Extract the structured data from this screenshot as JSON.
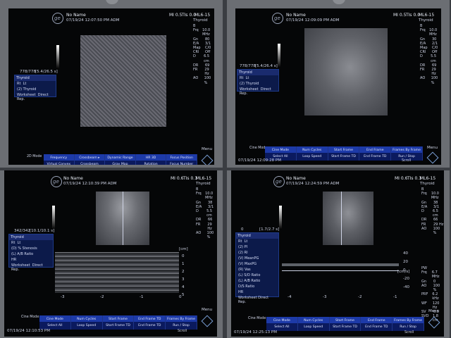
{
  "q1": {
    "patient": "No Name",
    "datetime": "07/19/24 12:07:50 PM ADM",
    "mi": "MI 0.5",
    "tis": "TIs 0.0",
    "probe": "ML6-15",
    "preset": "Thyroid",
    "params": [
      [
        "B",
        ""
      ],
      [
        "Frq",
        "10.0 MHz"
      ],
      [
        "Gn",
        "80"
      ],
      [
        "E/A",
        "3/1"
      ],
      [
        "Map",
        "C/0"
      ],
      [
        "CRI",
        "Off"
      ],
      [
        "D",
        "6.5 cm"
      ],
      [
        "DR",
        "69"
      ],
      [
        "FR",
        "29 Hz"
      ],
      [
        "AO",
        "100 %"
      ]
    ],
    "counter": "778/778",
    "cine_time": "[5.4/26.5 s]",
    "panel_title": "Thyroid",
    "panel_cols": [
      "Rt",
      "Lt"
    ],
    "panel_items": [
      "(2) Thyroid"
    ],
    "panel_footer": [
      "Worksheet",
      "Direct Rep."
    ],
    "mode": "2D\nMode",
    "softkeys": [
      "Frequency",
      "Crossbeam ▸",
      "Dynamic Range",
      "HR 3D",
      "Focus Position"
    ],
    "softkeys2": [
      "Virtual Convex",
      "Crossbeam",
      "Gray Map",
      "Rotation",
      "Focus Number"
    ],
    "menu": "Menu"
  },
  "q2": {
    "patient": "No Name",
    "datetime": "07/19/24 12:09:09 PM ADM",
    "mi": "MI 0.5",
    "tis": "TIs 0.0",
    "probe": "ML6-15",
    "preset": "Thyroid",
    "params": [
      [
        "B",
        ""
      ],
      [
        "Frq",
        "10.0 MHz"
      ],
      [
        "Gn",
        "30"
      ],
      [
        "E/A",
        "2/1"
      ],
      [
        "Map",
        "C/0"
      ],
      [
        "CRI",
        "Off"
      ],
      [
        "D",
        "5.5 cm"
      ],
      [
        "DR",
        "69"
      ],
      [
        "FR",
        "29 Hz"
      ],
      [
        "AO",
        "100 %"
      ]
    ],
    "counter": "778/778",
    "cine_time": "[5.4/26.4 s]",
    "panel_title": "Thyroid",
    "panel_cols": [
      "Rt",
      "Lt"
    ],
    "panel_items": [
      "(2) Thyroid"
    ],
    "panel_footer": [
      "Worksheet",
      "Direct Rep."
    ],
    "mode": "Cine\nMode",
    "softkeys": [
      "Cine Mode",
      "Num Cycles",
      "Start Frame",
      "End Frame",
      "Frames By Frame"
    ],
    "softkeys2": [
      "Select All",
      "Loop Speed",
      "Start Frame TD",
      "End Frame TD",
      "Run / Stop"
    ],
    "footer_time": "07/19/24 12:09:28 PM",
    "scroll": "Scroll",
    "menu": "Menu"
  },
  "q3": {
    "patient": "No Name",
    "datetime": "07/19/24 12:10:39 PM ADM",
    "mi": "MI 0.6",
    "tis": "TIs 0.1",
    "probe": "ML6-15",
    "preset": "Thyroid",
    "params": [
      [
        "B",
        ""
      ],
      [
        "Frq",
        "10.0 MHz"
      ],
      [
        "Gn",
        "38"
      ],
      [
        "E/A",
        "3/1"
      ],
      [
        "D",
        "5.5 cm"
      ],
      [
        "DR",
        "66"
      ],
      [
        "FR",
        "29 Hz"
      ],
      [
        "AO",
        "100 %"
      ]
    ],
    "counter": "342/342",
    "cine_time": "[10.1/10.1 s]",
    "panel_title": "Thyroid",
    "panel_cols": [
      "Rt",
      "Lt"
    ],
    "panel_items": [
      "(D) % Stenosis",
      "(L) A/B Ratio",
      "HR"
    ],
    "panel_footer": [
      "Worksheet",
      "Direct Rep."
    ],
    "mode": "Cine\nMode",
    "depth_unit": "[cm]",
    "mmode_scale": [
      "0",
      "1",
      "2",
      "3",
      "4",
      "5"
    ],
    "time_scale": [
      "-3",
      "-2",
      "-1",
      "0"
    ],
    "softkeys": [
      "Cine Mode",
      "Num Cycles",
      "Start Frame",
      "End Frame TD",
      "Frames By Frame"
    ],
    "softkeys2": [
      "Select All",
      "Loop Speed",
      "Start Frame TD",
      "End Frame TD",
      "Run / Stop"
    ],
    "footer_time": "07/19/24 12:10:53 PM",
    "scroll": "Scroll",
    "menu": "Menu"
  },
  "q4": {
    "patient": "No Name",
    "datetime": "07/19/24 12:24:59 PM ADM",
    "mi": "MI 0.6",
    "tis": "TIs 0.1",
    "probe": "ML6-15",
    "preset": "Thyroid",
    "params": [
      [
        "B",
        ""
      ],
      [
        "Frq",
        "10.0 MHz"
      ],
      [
        "Gn",
        "38"
      ],
      [
        "E/A",
        "3/1"
      ],
      [
        "D",
        "6.5 cm"
      ],
      [
        "DR",
        "66"
      ],
      [
        "FR",
        "29 Hz"
      ],
      [
        "AO",
        "100 %"
      ]
    ],
    "pw_params": [
      [
        "PW",
        ""
      ],
      [
        "Frq",
        "6.7 MHz"
      ],
      [
        "Gn",
        "0"
      ],
      [
        "AO",
        "100 %"
      ],
      [
        "PRF",
        "6.2 kHz"
      ],
      [
        "WF",
        "120 Hz"
      ],
      [
        "SV",
        "0.5"
      ],
      [
        "SVD",
        "1.8 cm"
      ]
    ],
    "counter": "0",
    "cine_time": "[1.7/2.7 s]",
    "panel_title": "Thyroid",
    "panel_cols": [
      "Rt",
      "Lt"
    ],
    "panel_items": [
      "(2) PI",
      "(2) RI",
      "(V) MeanPG",
      "(V) MaxPG",
      "(R) Vas",
      "(L) S/D Ratio",
      "(L) A/B Ratio",
      "D/S Ratio",
      "HR"
    ],
    "panel_footer": [
      "Worksheet",
      "Direct Rep."
    ],
    "mode": "Cine\nMode",
    "vel_unit": "[cm/s]",
    "vel_scale": [
      "40",
      "20",
      "0",
      "-20",
      "-40"
    ],
    "time_scale": [
      "-4",
      "-3",
      "-2",
      "-1"
    ],
    "softkeys": [
      "Cine Mode",
      "Num Cycles",
      "Start Frame",
      "End Frame",
      "Frames By Frame"
    ],
    "softkeys2": [
      "Select All",
      "Loop Speed",
      "Start Frame TD",
      "End Frame TD",
      "Run / Stop"
    ],
    "footer_time": "07/19/24 12:25:13 PM",
    "scroll": "Scroll",
    "menu": "Menu"
  }
}
